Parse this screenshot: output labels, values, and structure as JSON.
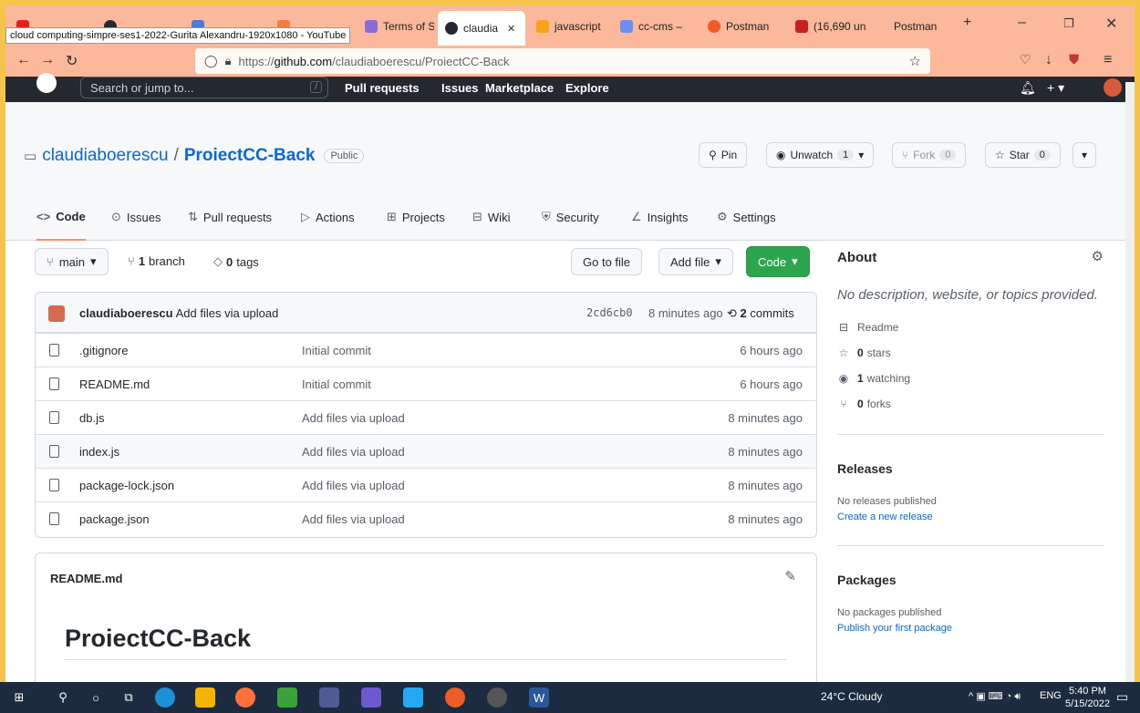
{
  "browser": {
    "tooltip": "cloud computing-simpre-ses1-2022-Gurita Alexandru-1920x1080 - YouTube",
    "tabs": [
      {
        "label": "Terms of S",
        "color": "#8a6cd6"
      },
      {
        "label": "claudia",
        "color": "#24292f"
      },
      {
        "label": "javascript",
        "color": "#f6a21a"
      },
      {
        "label": "cc-cms –",
        "color": "#6d8ef0"
      },
      {
        "label": "Postman",
        "color": "#ef5b25"
      },
      {
        "label": "(16,690 un",
        "color": "#c5221f"
      },
      {
        "label": "Postman",
        "color": "#fbb89a"
      }
    ],
    "active_tab_close": "✕",
    "new_tab": "+",
    "url_scheme": "https://",
    "url_host": "github.com",
    "url_path": "/claudiaboerescu/ProiectCC-Back"
  },
  "gh_header": {
    "search_placeholder": "Search or jump to...",
    "slash": "/",
    "nav": [
      "Pull requests",
      "Issues",
      "Marketplace",
      "Explore"
    ]
  },
  "repo": {
    "owner": "claudiaboerescu",
    "sep": "/",
    "name": "ProiectCC-Back",
    "visibility": "Public",
    "pin_label": "Pin",
    "unwatch_label": "Unwatch",
    "unwatch_count": "1",
    "fork_label": "Fork",
    "fork_count": "0",
    "star_label": "Star",
    "star_count": "0",
    "tabs": [
      {
        "label": "Code",
        "icon": "<>"
      },
      {
        "label": "Issues",
        "icon": "⊙"
      },
      {
        "label": "Pull requests",
        "icon": "⇅"
      },
      {
        "label": "Actions",
        "icon": "▷"
      },
      {
        "label": "Projects",
        "icon": "⊞"
      },
      {
        "label": "Wiki",
        "icon": "⊟"
      },
      {
        "label": "Security",
        "icon": "⛨"
      },
      {
        "label": "Insights",
        "icon": "∠"
      },
      {
        "label": "Settings",
        "icon": "⚙"
      }
    ]
  },
  "toolbar": {
    "branch": "main",
    "branch_count": "1",
    "branch_word": "branch",
    "tag_count": "0",
    "tag_word": "tags",
    "go_to_file": "Go to file",
    "add_file": "Add file",
    "code": "Code"
  },
  "commit": {
    "author": "claudiaboerescu",
    "message": "Add files via upload",
    "sha": "2cd6cb0",
    "time": "8 minutes ago",
    "count": "2",
    "count_word": "commits"
  },
  "files": [
    {
      "name": ".gitignore",
      "message": "Initial commit",
      "time": "6 hours ago"
    },
    {
      "name": "README.md",
      "message": "Initial commit",
      "time": "6 hours ago"
    },
    {
      "name": "db.js",
      "message": "Add files via upload",
      "time": "8 minutes ago"
    },
    {
      "name": "index.js",
      "message": "Add files via upload",
      "time": "8 minutes ago"
    },
    {
      "name": "package-lock.json",
      "message": "Add files via upload",
      "time": "8 minutes ago"
    },
    {
      "name": "package.json",
      "message": "Add files via upload",
      "time": "8 minutes ago"
    }
  ],
  "readme": {
    "label": "README.md",
    "heading": "ProiectCC-Back"
  },
  "about": {
    "title": "About",
    "description": "No description, website, or topics provided.",
    "readme": "Readme",
    "stars_count": "0",
    "stars_word": "stars",
    "watching_count": "1",
    "watching_word": "watching",
    "forks_count": "0",
    "forks_word": "forks"
  },
  "releases": {
    "title": "Releases",
    "none": "No releases published",
    "link": "Create a new release"
  },
  "packages": {
    "title": "Packages",
    "none": "No packages published",
    "link": "Publish your first package"
  },
  "taskbar": {
    "weather": "24°C  Cloudy",
    "lang": "ENG",
    "time": "5:40 PM",
    "date": "5/15/2022"
  }
}
